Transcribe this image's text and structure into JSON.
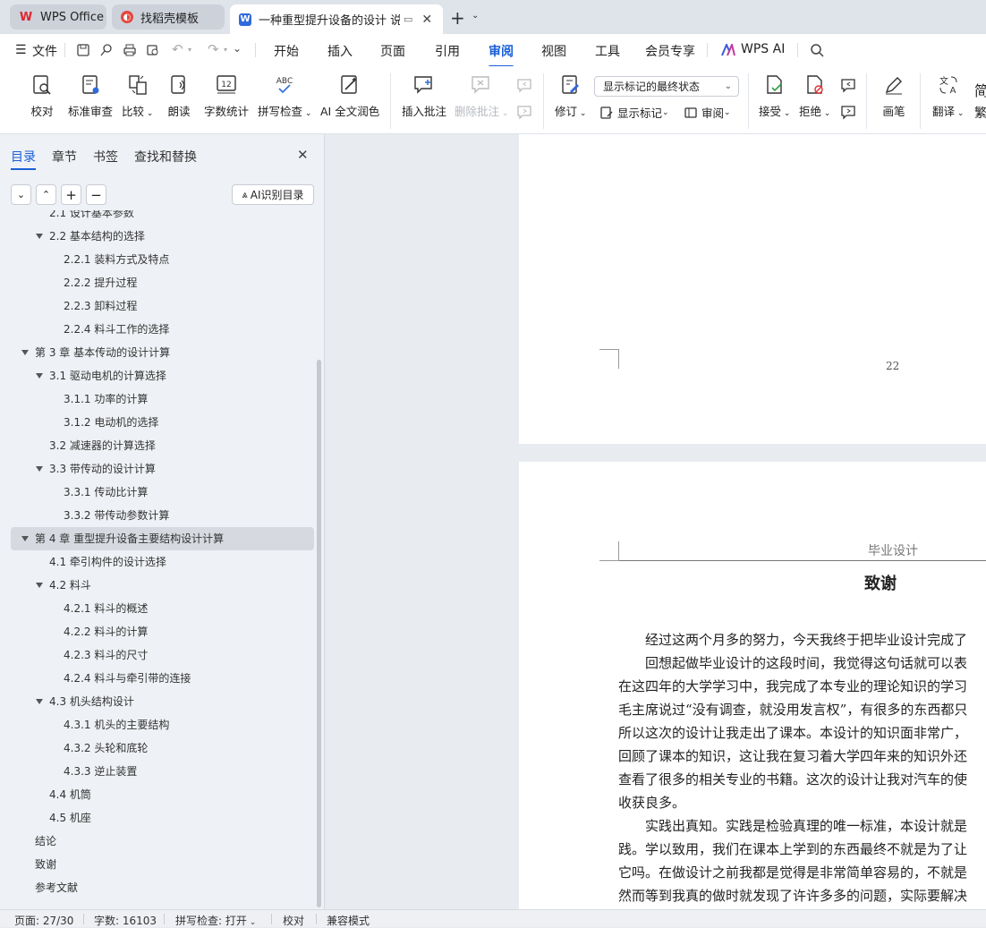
{
  "tabs": [
    {
      "label": "WPS Office",
      "icon": "wps-logo-icon"
    },
    {
      "label": "找稻壳模板",
      "icon": "docer-icon"
    },
    {
      "label": "一种重型提升设备的设计 说明",
      "icon": "writer-doc-icon"
    }
  ],
  "menu": {
    "file": "文件",
    "items": [
      "开始",
      "插入",
      "页面",
      "引用",
      "审阅",
      "视图",
      "工具",
      "会员专享"
    ],
    "active": "审阅",
    "ai": "WPS AI"
  },
  "ribbon": {
    "proofread": "校对",
    "standard_review": "标准审查",
    "compare": "比较",
    "read_aloud": "朗读",
    "word_count": "字数统计",
    "spell_check": "拼写检查",
    "ai_polish": "AI 全文润色",
    "insert_comment": "插入批注",
    "delete_comment": "删除批注",
    "track_changes": "修订",
    "markup_select": "显示标记的最终状态",
    "show_markup": "显示标记",
    "review": "审阅",
    "accept": "接受",
    "reject": "拒绝",
    "pen": "画笔",
    "translate": "翻译",
    "trad_simp_top": "简",
    "trad_simp_bottom": "繁"
  },
  "sidebar": {
    "tabs": [
      "目录",
      "章节",
      "书签",
      "查找和替换"
    ],
    "ai_toc": "AI识别目录",
    "toc": [
      {
        "label": "2.1 设计基本参数",
        "level": 2,
        "arrow": false
      },
      {
        "label": "2.2 基本结构的选择",
        "level": 2,
        "arrow": true
      },
      {
        "label": "2.2.1 装料方式及特点",
        "level": 3,
        "arrow": false
      },
      {
        "label": "2.2.2 提升过程",
        "level": 3,
        "arrow": false
      },
      {
        "label": "2.2.3 卸料过程",
        "level": 3,
        "arrow": false
      },
      {
        "label": "2.2.4 料斗工作的选择",
        "level": 3,
        "arrow": false
      },
      {
        "label": "第 3 章  基本传动的设计计算",
        "level": 1,
        "arrow": true
      },
      {
        "label": "3.1 驱动电机的计算选择",
        "level": 2,
        "arrow": true
      },
      {
        "label": "3.1.1 功率的计算",
        "level": 3,
        "arrow": false
      },
      {
        "label": "3.1.2 电动机的选择",
        "level": 3,
        "arrow": false
      },
      {
        "label": "3.2 减速器的计算选择",
        "level": 2,
        "arrow": false
      },
      {
        "label": "3.3 带传动的设计计算",
        "level": 2,
        "arrow": true
      },
      {
        "label": "3.3.1 传动比计算",
        "level": 3,
        "arrow": false
      },
      {
        "label": "3.3.2 带传动参数计算",
        "level": 3,
        "arrow": false
      },
      {
        "label": "第 4 章  重型提升设备主要结构设计计算",
        "level": 1,
        "arrow": true,
        "selected": true
      },
      {
        "label": "4.1 牵引构件的设计选择",
        "level": 2,
        "arrow": false
      },
      {
        "label": "4.2 料斗",
        "level": 2,
        "arrow": true
      },
      {
        "label": "4.2.1 料斗的概述",
        "level": 3,
        "arrow": false
      },
      {
        "label": "4.2.2 料斗的计算",
        "level": 3,
        "arrow": false
      },
      {
        "label": "4.2.3 料斗的尺寸",
        "level": 3,
        "arrow": false
      },
      {
        "label": "4.2.4 料斗与牵引带的连接",
        "level": 3,
        "arrow": false
      },
      {
        "label": "4.3 机头结构设计",
        "level": 2,
        "arrow": true
      },
      {
        "label": "4.3.1 机头的主要结构",
        "level": 3,
        "arrow": false
      },
      {
        "label": "4.3.2 头轮和底轮",
        "level": 3,
        "arrow": false
      },
      {
        "label": "4.3.3 逆止装置",
        "level": 3,
        "arrow": false
      },
      {
        "label": "4.4 机筒",
        "level": 2,
        "arrow": false
      },
      {
        "label": "4.5 机座",
        "level": 2,
        "arrow": false
      },
      {
        "label": "结论",
        "level": 1,
        "arrow": false
      },
      {
        "label": "致谢",
        "level": 1,
        "arrow": false
      },
      {
        "label": "参考文献",
        "level": 1,
        "arrow": false
      }
    ]
  },
  "document": {
    "page_number": "22",
    "header": "毕业设计",
    "title": "致谢",
    "lines": [
      "　　经过这两个月多的努力，今天我终于把毕业设计完成了",
      "　　回想起做毕业设计的这段时间，我觉得这句话就可以表",
      "在这四年的大学学习中，我完成了本专业的理论知识的学习",
      "毛主席说过“没有调查，就没用发言权”，有很多的东西都只",
      "所以这次的设计让我走出了课本。本设计的知识面非常广，",
      "回顾了课本的知识，这让我在复习着大学四年来的知识外还",
      "查看了很多的相关专业的书籍。这次的设计让我对汽车的使",
      "收获良多。",
      "　　实践出真知。实践是检验真理的唯一标准，本设计就是",
      "践。学以致用，我们在课本上学到的东西最终不就是为了让",
      "它吗。在做设计之前我都是觉得是非常简单容易的，不就是",
      "然而等到我真的做时就发现了许许多多的问题，实际要解决"
    ]
  },
  "status": {
    "page": "页面: 27/30",
    "words": "字数: 16103",
    "spell": "拼写检查: 打开",
    "proof": "校对",
    "compat": "兼容模式"
  }
}
